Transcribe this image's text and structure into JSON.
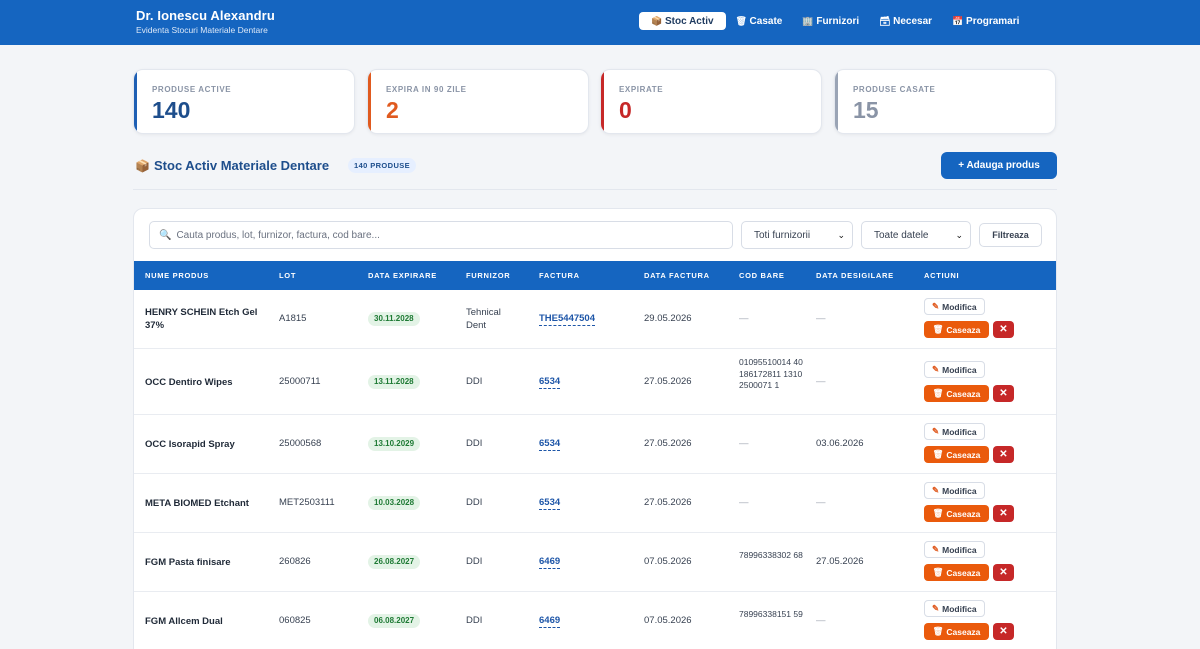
{
  "header": {
    "title": "Dr. Ionescu Alexandru",
    "subtitle": "Evidenta Stocuri Materiale Dentare",
    "nav": [
      {
        "label": "Stoc Activ",
        "icon": "box-icon",
        "glyph": "📦",
        "active": true
      },
      {
        "label": "Casate",
        "icon": "trash-icon",
        "glyph": "🗑"
      },
      {
        "label": "Furnizori",
        "icon": "building-icon",
        "glyph": "🏢"
      },
      {
        "label": "Necesar",
        "icon": "clipboard-icon",
        "glyph": "🗃"
      },
      {
        "label": "Programari",
        "icon": "calendar-icon",
        "glyph": "📅"
      }
    ]
  },
  "stats": [
    {
      "label": "PRODUSE ACTIVE",
      "value": "140",
      "color": "#1e4e8c"
    },
    {
      "label": "EXPIRA IN 90 ZILE",
      "value": "2",
      "color": "#e05a1f"
    },
    {
      "label": "EXPIRATE",
      "value": "0",
      "color": "#c62828"
    },
    {
      "label": "PRODUSE CASATE",
      "value": "15",
      "color": "#8a94a6"
    }
  ],
  "section": {
    "icon": "box-icon",
    "title": "Stoc Activ Materiale Dentare",
    "badge": "140 PRODUSE",
    "add_button": "+ Adauga produs"
  },
  "filters": {
    "search_placeholder": "Cauta produs, lot, furnizor, factura, cod bare...",
    "supplier_select": "Toti furnizorii",
    "date_select": "Toate datele",
    "filter_button": "Filtreaza"
  },
  "table": {
    "columns": [
      "NUME PRODUS",
      "LOT",
      "DATA EXPIRARE",
      "FURNIZOR",
      "FACTURA",
      "DATA FACTURA",
      "COD BARE",
      "DATA DESIGILARE",
      "ACTIUNI"
    ],
    "actions": {
      "edit": "Modifica",
      "discard": "Caseaza",
      "delete": "✕"
    },
    "rows": [
      {
        "name": "HENRY SCHEIN Etch Gel 37%",
        "lot": "A1815",
        "expiry": "30.11.2028",
        "supplier": "Tehnical Dent",
        "invoice": "THE5447504",
        "invoice_date": "29.05.2026",
        "barcode": "—",
        "unseal_date": "—"
      },
      {
        "name": "OCC Dentiro Wipes",
        "lot": "25000711",
        "expiry": "13.11.2028",
        "supplier": "DDI",
        "invoice": "6534",
        "invoice_date": "27.05.2026",
        "barcode": "01095510014 40186172811 13102500071 1",
        "unseal_date": "—"
      },
      {
        "name": "OCC Isorapid Spray",
        "lot": "25000568",
        "expiry": "13.10.2029",
        "supplier": "DDI",
        "invoice": "6534",
        "invoice_date": "27.05.2026",
        "barcode": "—",
        "unseal_date": "03.06.2026"
      },
      {
        "name": "META BIOMED Etchant",
        "lot": "MET2503111",
        "expiry": "10.03.2028",
        "supplier": "DDI",
        "invoice": "6534",
        "invoice_date": "27.05.2026",
        "barcode": "—",
        "unseal_date": "—"
      },
      {
        "name": "FGM Pasta finisare",
        "lot": "260826",
        "expiry": "26.08.2027",
        "supplier": "DDI",
        "invoice": "6469",
        "invoice_date": "07.05.2026",
        "barcode": "78996338302 68",
        "unseal_date": "27.05.2026"
      },
      {
        "name": "FGM Allcem Dual",
        "lot": "060825",
        "expiry": "06.08.2027",
        "supplier": "DDI",
        "invoice": "6469",
        "invoice_date": "07.05.2026",
        "barcode": "78996338151 59",
        "unseal_date": "—"
      }
    ]
  }
}
